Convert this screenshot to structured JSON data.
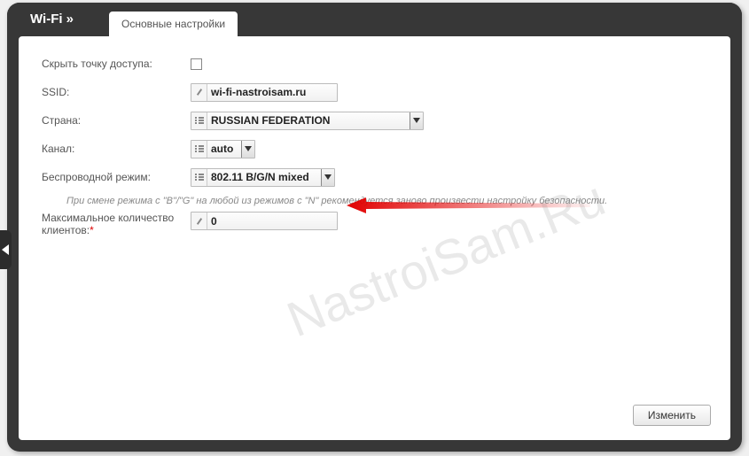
{
  "header": {
    "title": "Wi-Fi »",
    "tab_label": "Основные настройки"
  },
  "fields": {
    "hide_ap": {
      "label": "Скрыть точку доступа:",
      "checked": false
    },
    "ssid": {
      "label": "SSID:",
      "value": "wi-fi-nastroisam.ru"
    },
    "country": {
      "label": "Страна:",
      "value": "RUSSIAN FEDERATION"
    },
    "channel": {
      "label": "Канал:",
      "value": "auto"
    },
    "mode": {
      "label": "Беспроводной режим:",
      "value": "802.11 B/G/N mixed"
    },
    "max_clients": {
      "label_line1": "Максимальное количество",
      "label_line2": "клиентов:",
      "value": "0"
    }
  },
  "hint": "При смене режима с \"B\"/\"G\" на любой из режимов с \"N\" рекомендуется заново произвести настройку безопасности.",
  "submit_label": "Изменить",
  "watermark": "NastroiSam.Ru"
}
